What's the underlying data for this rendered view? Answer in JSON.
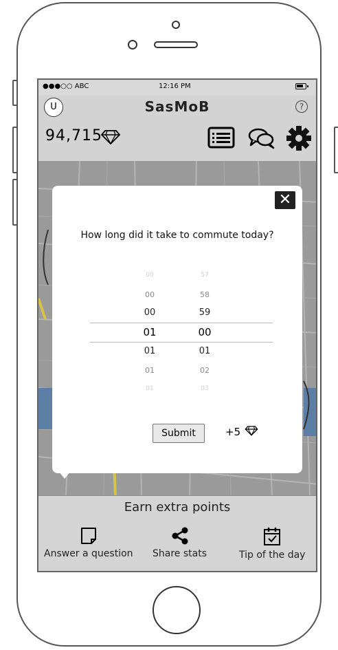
{
  "status_bar": {
    "carrier": "●●●○○ ABC",
    "time": "12:16 PM"
  },
  "header": {
    "avatar_letter": "U",
    "title": "SasMoB",
    "help_symbol": "?"
  },
  "toolbar": {
    "points": "94,715",
    "icons": [
      "diamond-icon",
      "list-icon",
      "chat-icon",
      "gear-icon"
    ]
  },
  "modal": {
    "close_label": "✕",
    "question": "How long did it take to commute today?",
    "picker": {
      "hours": [
        "00",
        "00",
        "00",
        "01",
        "01",
        "01",
        "01"
      ],
      "minutes": [
        "57",
        "58",
        "59",
        "00",
        "01",
        "02",
        "03"
      ],
      "selected_hours": "01",
      "selected_minutes": "00"
    },
    "submit_label": "Submit",
    "reward": "+5"
  },
  "bottom_panel": {
    "title": "Earn extra points",
    "actions": [
      {
        "label": "Answer a question",
        "icon": "note-icon"
      },
      {
        "label": "Share stats",
        "icon": "share-icon"
      },
      {
        "label": "Tip of the day",
        "icon": "calendar-check-icon"
      }
    ]
  }
}
